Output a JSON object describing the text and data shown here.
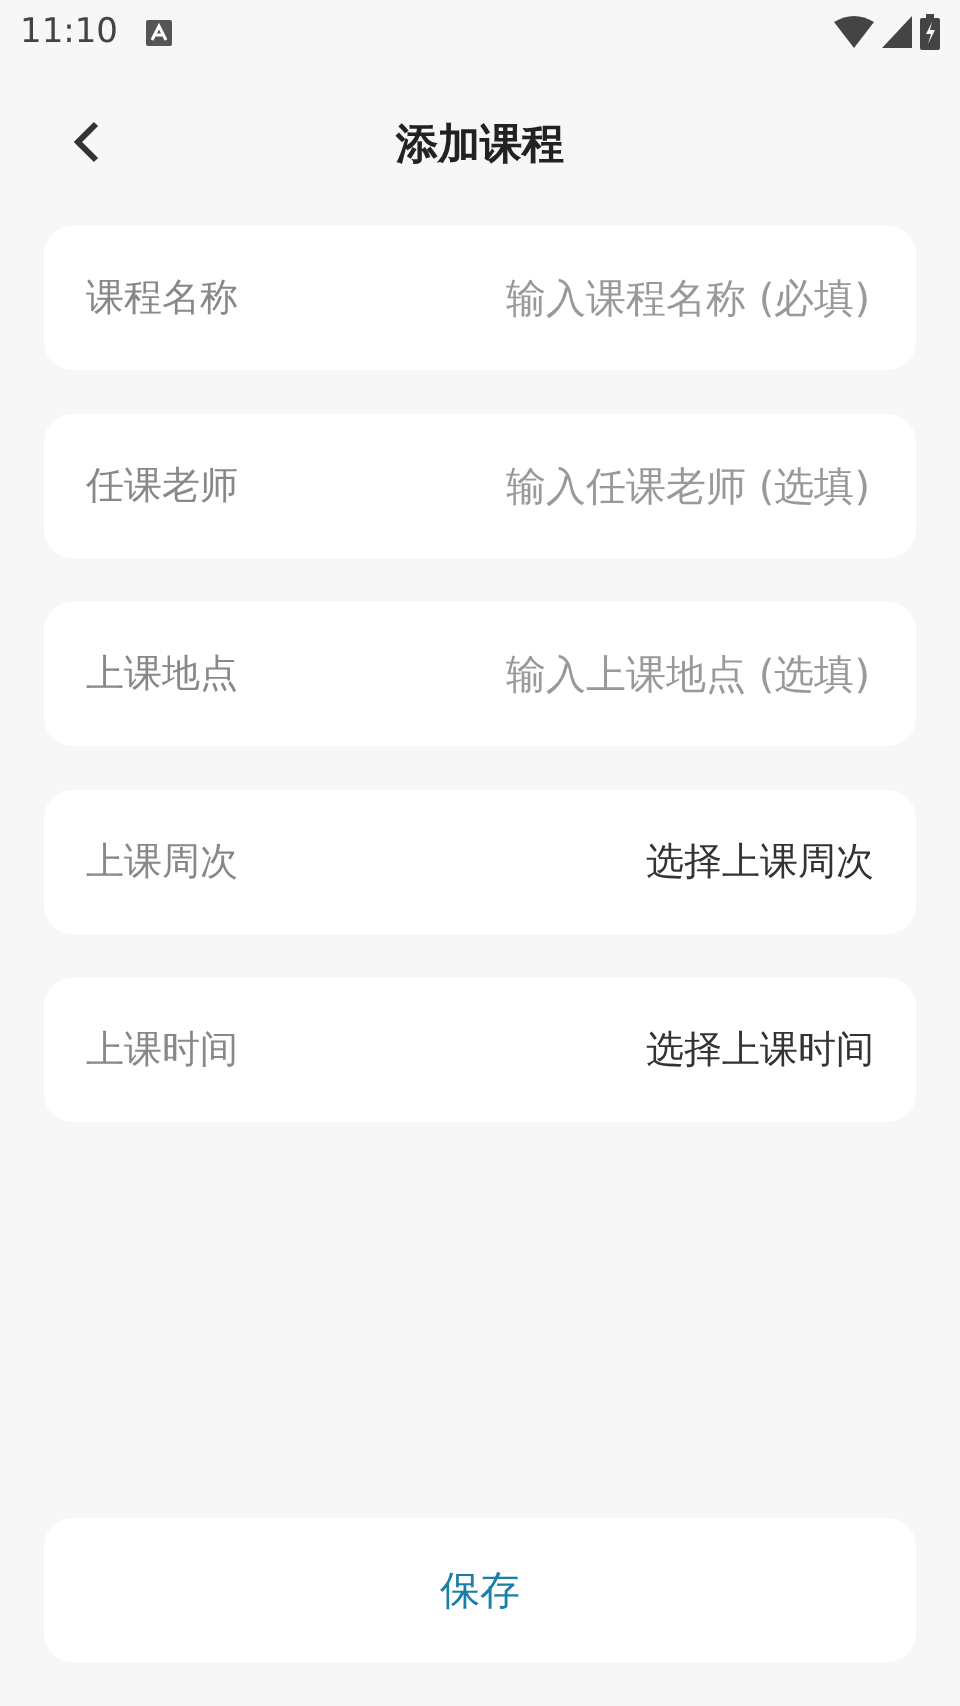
{
  "status_bar": {
    "time": "11:10"
  },
  "header": {
    "title": "添加课程"
  },
  "fields": [
    {
      "kind": "input",
      "label": "课程名称",
      "placeholder": "输入课程名称 (必填)"
    },
    {
      "kind": "input",
      "label": "任课老师",
      "placeholder": "输入任课老师 (选填)"
    },
    {
      "kind": "input",
      "label": "上课地点",
      "placeholder": "输入上课地点 (选填)"
    },
    {
      "kind": "select",
      "label": "上课周次",
      "value": "选择上课周次"
    },
    {
      "kind": "select",
      "label": "上课时间",
      "value": "选择上课时间"
    }
  ],
  "save_button": {
    "label": "保存"
  }
}
